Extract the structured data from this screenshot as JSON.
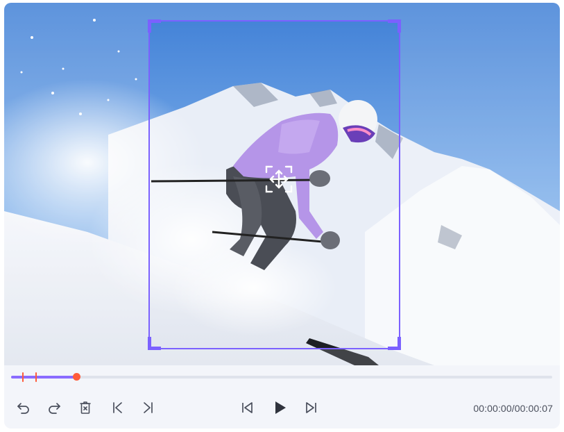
{
  "player": {
    "time_readout": "00:00:00/00:00:07",
    "current_time": "00:00:00",
    "duration": "00:00:07",
    "progress": 0.12
  },
  "timeline": {
    "markers": [
      0.02,
      0.045
    ]
  },
  "controls": {
    "left": [
      "undo-icon",
      "redo-icon",
      "delete-icon",
      "previous-marker-icon",
      "next-marker-icon"
    ],
    "center": [
      "previous-frame-icon",
      "play-icon",
      "next-frame-icon"
    ]
  },
  "crop": {
    "handle_icon": "move-icon",
    "accent_color": "#7b61ff"
  },
  "colors": {
    "accent": "#8a6cff",
    "playhead": "#ff5b3a",
    "icon": "#4a4f5c"
  }
}
